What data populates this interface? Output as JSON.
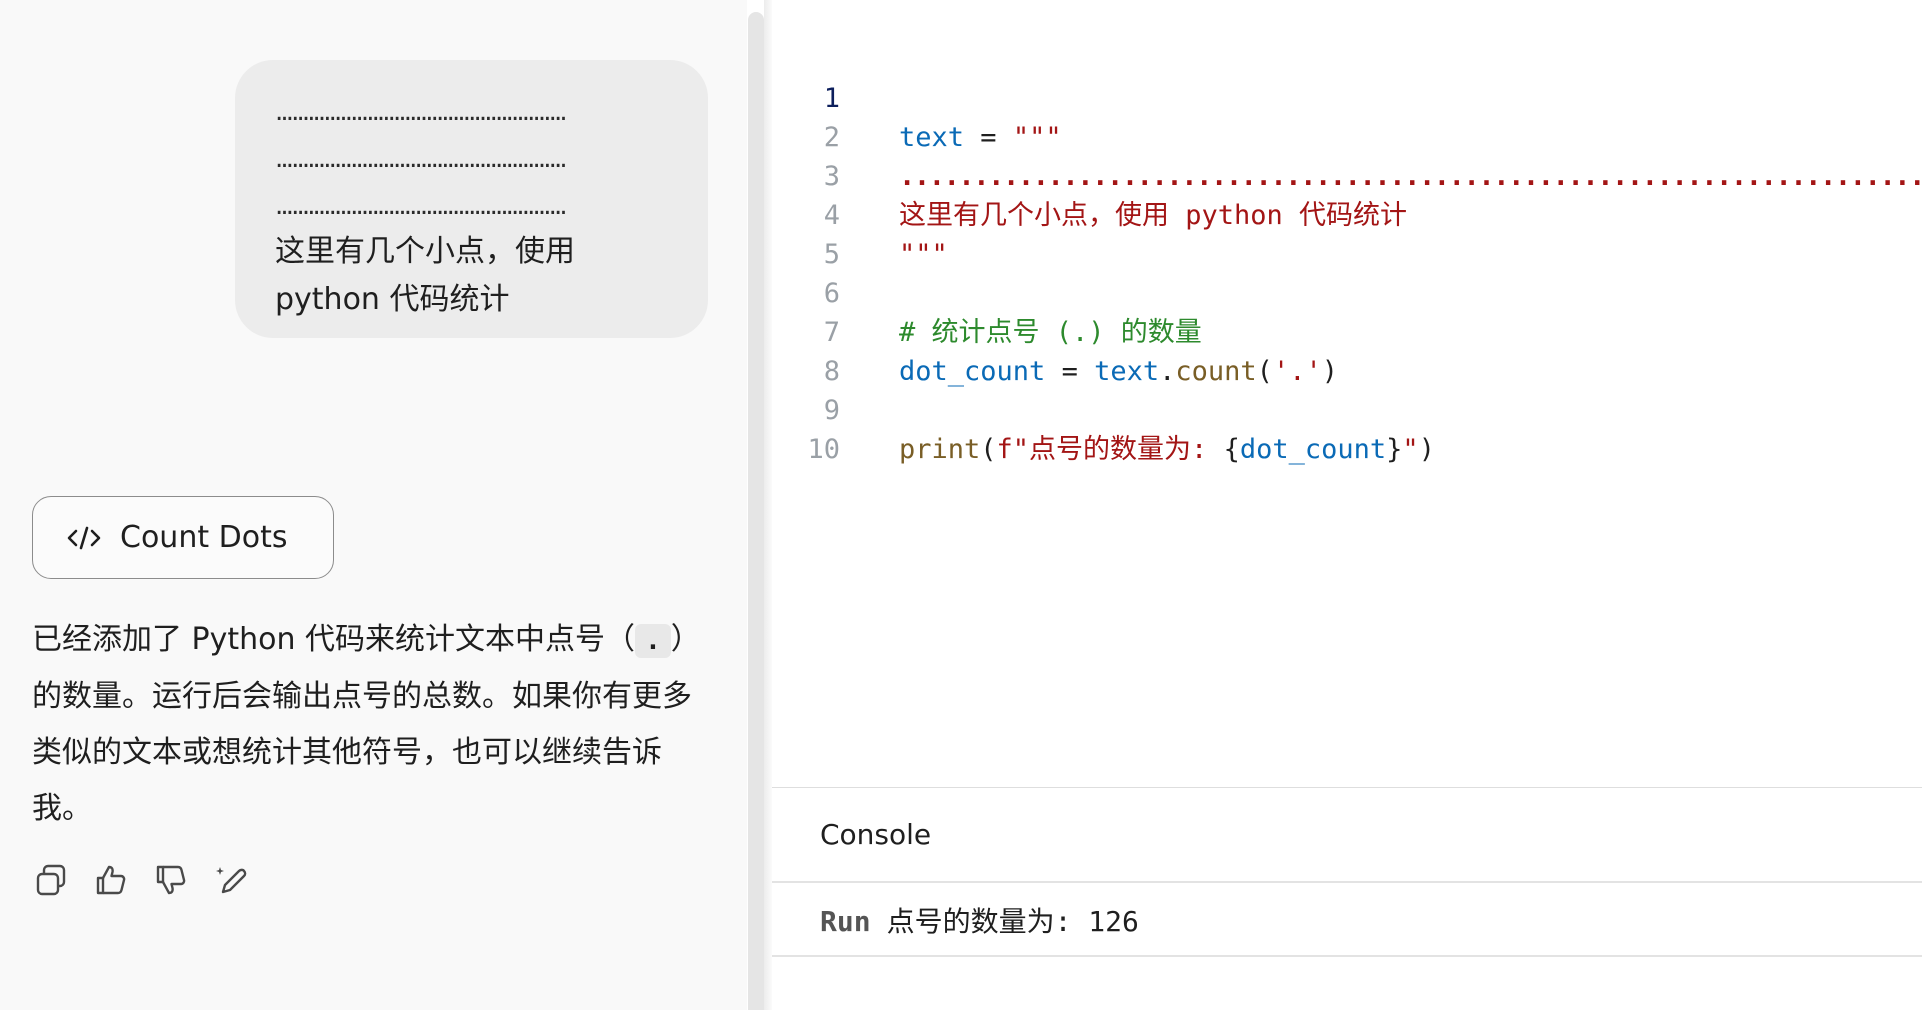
{
  "user_message": {
    "dot_lines": [
      "......................................................",
      "......................................................",
      "......................................................"
    ],
    "text": "这里有几个小点，使用 python 代码统计"
  },
  "artifact_card": {
    "icon": "code-icon",
    "label": "Count Dots"
  },
  "assistant_reply": {
    "text_before": "已经添加了 Python 代码来统计文本中点号（",
    "inline_code": ".",
    "text_after": "）的数量。运行后会输出点号的总数。如果你有更多类似的文本或想统计其他符号，也可以继续告诉我。"
  },
  "reply_actions": [
    {
      "name": "copy",
      "icon": "copy-icon"
    },
    {
      "name": "thumbs-up",
      "icon": "thumbs-up-icon"
    },
    {
      "name": "thumbs-down",
      "icon": "thumbs-down-icon"
    },
    {
      "name": "edit",
      "icon": "edit-sparkle-icon"
    }
  ],
  "editor": {
    "line_numbers": [
      "1",
      "2",
      "3",
      "4",
      "5",
      "6",
      "7",
      "8",
      "9",
      "10"
    ],
    "active_line": "1",
    "lines": {
      "l1_var": "text",
      "l1_eq": " = ",
      "l1_str": "\"\"\"",
      "l2_dots": "..................................................................................................................................................",
      "l3_text": "这里有几个小点，使用 python 代码统计",
      "l4_str": "\"\"\"",
      "l6_comment": "# 统计点号 (.) 的数量",
      "l7_var": "dot_count",
      "l7_eq": " = ",
      "l7_obj": "text",
      "l7_dot": ".",
      "l7_fn": "count",
      "l7_open": "(",
      "l7_arg": "'.'",
      "l7_close": ")",
      "l9_fn": "print",
      "l9_open": "(",
      "l9_str1": "f\"点号的数量为: ",
      "l9_brace_open": "{",
      "l9_var": "dot_count",
      "l9_brace_close": "}",
      "l9_str2": "\"",
      "l9_close": ")"
    }
  },
  "console": {
    "title": "Console",
    "run_label": "Run",
    "output": "点号的数量为: 126"
  },
  "colors": {
    "keyword_var": "#0a6ab6",
    "string": "#a31515",
    "function": "#795e26",
    "comment": "#2d8a2d"
  }
}
